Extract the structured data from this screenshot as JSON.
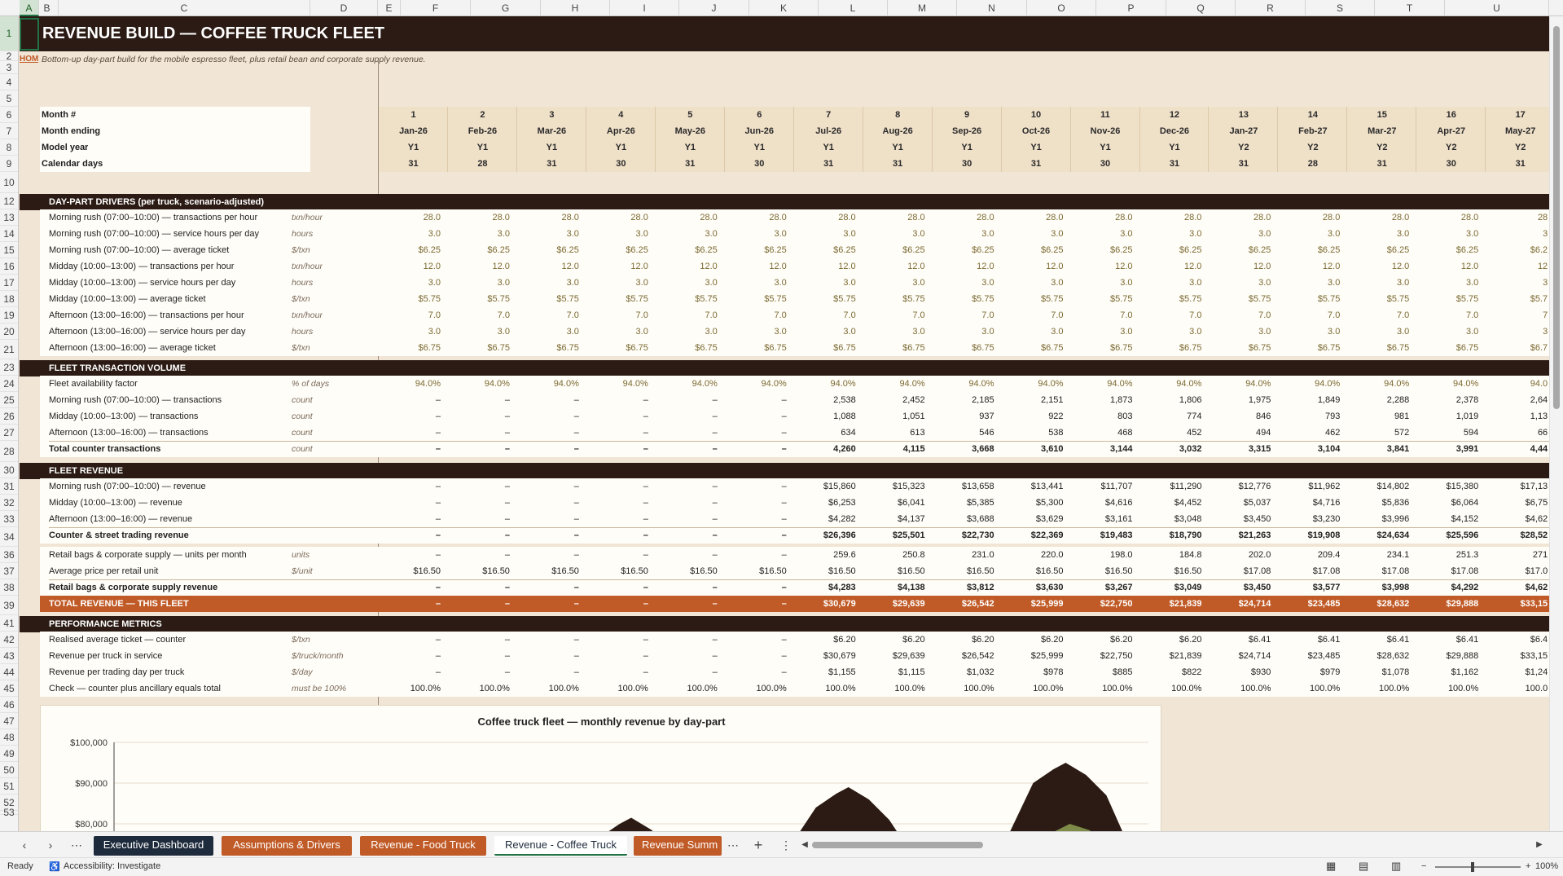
{
  "sheet": {
    "title": "REVENUE BUILD — COFFEE TRUCK FLEET",
    "home_link": "HOM",
    "subtitle": "Bottom-up day-part build for the mobile espresso fleet, plus retail bean and corporate supply revenue.",
    "timeline_labels": [
      "Month #",
      "Month ending",
      "Model year",
      "Calendar days"
    ]
  },
  "columns": [
    "A",
    "B",
    "C",
    "D",
    "E",
    "F",
    "G",
    "H",
    "I",
    "J",
    "K",
    "L",
    "M",
    "N",
    "O",
    "P",
    "Q",
    "R",
    "S",
    "T",
    "U"
  ],
  "selected_column": "A",
  "selected_row": "1",
  "rows": [
    "1",
    "2",
    "3",
    "4",
    "5",
    "6",
    "7",
    "8",
    "9",
    "10",
    "12",
    "13",
    "14",
    "15",
    "16",
    "17",
    "18",
    "19",
    "20",
    "21",
    "23",
    "24",
    "25",
    "26",
    "27",
    "28",
    "30",
    "31",
    "32",
    "33",
    "34",
    "36",
    "37",
    "38",
    "39",
    "41",
    "42",
    "43",
    "44",
    "45",
    "46",
    "47",
    "48",
    "49",
    "50",
    "51",
    "52",
    "53"
  ],
  "months": [
    {
      "n": "1",
      "end": "Jan-26",
      "yr": "Y1",
      "days": "31"
    },
    {
      "n": "2",
      "end": "Feb-26",
      "yr": "Y1",
      "days": "28"
    },
    {
      "n": "3",
      "end": "Mar-26",
      "yr": "Y1",
      "days": "31"
    },
    {
      "n": "4",
      "end": "Apr-26",
      "yr": "Y1",
      "days": "30"
    },
    {
      "n": "5",
      "end": "May-26",
      "yr": "Y1",
      "days": "31"
    },
    {
      "n": "6",
      "end": "Jun-26",
      "yr": "Y1",
      "days": "30"
    },
    {
      "n": "7",
      "end": "Jul-26",
      "yr": "Y1",
      "days": "31"
    },
    {
      "n": "8",
      "end": "Aug-26",
      "yr": "Y1",
      "days": "31"
    },
    {
      "n": "9",
      "end": "Sep-26",
      "yr": "Y1",
      "days": "30"
    },
    {
      "n": "10",
      "end": "Oct-26",
      "yr": "Y1",
      "days": "31"
    },
    {
      "n": "11",
      "end": "Nov-26",
      "yr": "Y1",
      "days": "30"
    },
    {
      "n": "12",
      "end": "Dec-26",
      "yr": "Y1",
      "days": "31"
    },
    {
      "n": "13",
      "end": "Jan-27",
      "yr": "Y2",
      "days": "31"
    },
    {
      "n": "14",
      "end": "Feb-27",
      "yr": "Y2",
      "days": "28"
    },
    {
      "n": "15",
      "end": "Mar-27",
      "yr": "Y2",
      "days": "31"
    },
    {
      "n": "16",
      "end": "Apr-27",
      "yr": "Y2",
      "days": "30"
    },
    {
      "n": "17",
      "end": "May-27",
      "yr": "Y2",
      "days": "31"
    }
  ],
  "sections": {
    "drivers": "DAY-PART DRIVERS  (per truck, scenario-adjusted)",
    "volume": "FLEET TRANSACTION VOLUME",
    "revenue": "FLEET REVENUE",
    "metrics": "PERFORMANCE METRICS"
  },
  "driver_rows": [
    {
      "label": "Morning rush (07:00–10:00) — transactions per hour",
      "unit": "txn/hour",
      "v": "28.0",
      "last": "28"
    },
    {
      "label": "Morning rush (07:00–10:00) — service hours per day",
      "unit": "hours",
      "v": "3.0",
      "last": "3"
    },
    {
      "label": "Morning rush (07:00–10:00) — average ticket",
      "unit": "$/txn",
      "v": "$6.25",
      "last": "$6.2"
    },
    {
      "label": "Midday (10:00–13:00) — transactions per hour",
      "unit": "txn/hour",
      "v": "12.0",
      "last": "12"
    },
    {
      "label": "Midday (10:00–13:00) — service hours per day",
      "unit": "hours",
      "v": "3.0",
      "last": "3"
    },
    {
      "label": "Midday (10:00–13:00) — average ticket",
      "unit": "$/txn",
      "v": "$5.75",
      "last": "$5.7"
    },
    {
      "label": "Afternoon (13:00–16:00) — transactions per hour",
      "unit": "txn/hour",
      "v": "7.0",
      "last": "7"
    },
    {
      "label": "Afternoon (13:00–16:00) — service hours per day",
      "unit": "hours",
      "v": "3.0",
      "last": "3"
    },
    {
      "label": "Afternoon (13:00–16:00) — average ticket",
      "unit": "$/txn",
      "v": "$6.75",
      "last": "$6.7"
    }
  ],
  "volume_rows": [
    {
      "label": "Fleet availability factor",
      "unit": "% of days",
      "bold": false,
      "inp": true,
      "vals": [
        "94.0%",
        "94.0%",
        "94.0%",
        "94.0%",
        "94.0%",
        "94.0%",
        "94.0%",
        "94.0%",
        "94.0%",
        "94.0%",
        "94.0%",
        "94.0%",
        "94.0%",
        "94.0%",
        "94.0%",
        "94.0%",
        "94.0"
      ]
    },
    {
      "label": "Morning rush (07:00–10:00) — transactions",
      "unit": "count",
      "bold": false,
      "inp": false,
      "vals": [
        "–",
        "–",
        "–",
        "–",
        "–",
        "–",
        "2,538",
        "2,452",
        "2,185",
        "2,151",
        "1,873",
        "1,806",
        "1,975",
        "1,849",
        "2,288",
        "2,378",
        "2,64"
      ]
    },
    {
      "label": "Midday (10:00–13:00) — transactions",
      "unit": "count",
      "bold": false,
      "inp": false,
      "vals": [
        "–",
        "–",
        "–",
        "–",
        "–",
        "–",
        "1,088",
        "1,051",
        "937",
        "922",
        "803",
        "774",
        "846",
        "793",
        "981",
        "1,019",
        "1,13"
      ]
    },
    {
      "label": "Afternoon (13:00–16:00) — transactions",
      "unit": "count",
      "bold": false,
      "inp": false,
      "vals": [
        "–",
        "–",
        "–",
        "–",
        "–",
        "–",
        "634",
        "613",
        "546",
        "538",
        "468",
        "452",
        "494",
        "462",
        "572",
        "594",
        "66"
      ]
    },
    {
      "label": "Total counter transactions",
      "unit": "count",
      "bold": true,
      "inp": false,
      "vals": [
        "–",
        "–",
        "–",
        "–",
        "–",
        "–",
        "4,260",
        "4,115",
        "3,668",
        "3,610",
        "3,144",
        "3,032",
        "3,315",
        "3,104",
        "3,841",
        "3,991",
        "4,44"
      ]
    }
  ],
  "revenue_rows": [
    {
      "label": "Morning rush (07:00–10:00) — revenue",
      "unit": "",
      "bold": false,
      "vals": [
        "–",
        "–",
        "–",
        "–",
        "–",
        "–",
        "$15,860",
        "$15,323",
        "$13,658",
        "$13,441",
        "$11,707",
        "$11,290",
        "$12,776",
        "$11,962",
        "$14,802",
        "$15,380",
        "$17,13"
      ]
    },
    {
      "label": "Midday (10:00–13:00) — revenue",
      "unit": "",
      "bold": false,
      "vals": [
        "–",
        "–",
        "–",
        "–",
        "–",
        "–",
        "$6,253",
        "$6,041",
        "$5,385",
        "$5,300",
        "$4,616",
        "$4,452",
        "$5,037",
        "$4,716",
        "$5,836",
        "$6,064",
        "$6,75"
      ]
    },
    {
      "label": "Afternoon (13:00–16:00) — revenue",
      "unit": "",
      "bold": false,
      "vals": [
        "–",
        "–",
        "–",
        "–",
        "–",
        "–",
        "$4,282",
        "$4,137",
        "$3,688",
        "$3,629",
        "$3,161",
        "$3,048",
        "$3,450",
        "$3,230",
        "$3,996",
        "$4,152",
        "$4,62"
      ]
    },
    {
      "label": "Counter & street trading revenue",
      "unit": "",
      "bold": true,
      "vals": [
        "–",
        "–",
        "–",
        "–",
        "–",
        "–",
        "$26,396",
        "$25,501",
        "$22,730",
        "$22,369",
        "$19,483",
        "$18,790",
        "$21,263",
        "$19,908",
        "$24,634",
        "$25,596",
        "$28,52"
      ]
    }
  ],
  "retail_rows": [
    {
      "label": "Retail bags & corporate supply — units per month",
      "unit": "units",
      "bold": false,
      "vals": [
        "–",
        "–",
        "–",
        "–",
        "–",
        "–",
        "259.6",
        "250.8",
        "231.0",
        "220.0",
        "198.0",
        "184.8",
        "202.0",
        "209.4",
        "234.1",
        "251.3",
        "271"
      ]
    },
    {
      "label": "Average price per retail unit",
      "unit": "$/unit",
      "bold": false,
      "vals": [
        "$16.50",
        "$16.50",
        "$16.50",
        "$16.50",
        "$16.50",
        "$16.50",
        "$16.50",
        "$16.50",
        "$16.50",
        "$16.50",
        "$16.50",
        "$16.50",
        "$17.08",
        "$17.08",
        "$17.08",
        "$17.08",
        "$17.0"
      ]
    },
    {
      "label": "Retail bags & corporate supply revenue",
      "unit": "",
      "bold": true,
      "vals": [
        "–",
        "–",
        "–",
        "–",
        "–",
        "–",
        "$4,283",
        "$4,138",
        "$3,812",
        "$3,630",
        "$3,267",
        "$3,049",
        "$3,450",
        "$3,577",
        "$3,998",
        "$4,292",
        "$4,62"
      ]
    }
  ],
  "total_row": {
    "label": "TOTAL REVENUE — THIS FLEET",
    "vals": [
      "–",
      "–",
      "–",
      "–",
      "–",
      "–",
      "$30,679",
      "$29,639",
      "$26,542",
      "$25,999",
      "$22,750",
      "$21,839",
      "$24,714",
      "$23,485",
      "$28,632",
      "$29,888",
      "$33,15"
    ]
  },
  "metric_rows": [
    {
      "label": "Realised average ticket — counter",
      "unit": "$/txn",
      "bold": false,
      "vals": [
        "–",
        "–",
        "–",
        "–",
        "–",
        "–",
        "$6.20",
        "$6.20",
        "$6.20",
        "$6.20",
        "$6.20",
        "$6.20",
        "$6.41",
        "$6.41",
        "$6.41",
        "$6.41",
        "$6.4"
      ]
    },
    {
      "label": "Revenue per truck in service",
      "unit": "$/truck/month",
      "bold": false,
      "vals": [
        "–",
        "–",
        "–",
        "–",
        "–",
        "–",
        "$30,679",
        "$29,639",
        "$26,542",
        "$25,999",
        "$22,750",
        "$21,839",
        "$24,714",
        "$23,485",
        "$28,632",
        "$29,888",
        "$33,15"
      ]
    },
    {
      "label": "Revenue per trading day per truck",
      "unit": "$/day",
      "bold": false,
      "vals": [
        "–",
        "–",
        "–",
        "–",
        "–",
        "–",
        "$1,155",
        "$1,115",
        "$1,032",
        "$978",
        "$885",
        "$822",
        "$930",
        "$979",
        "$1,078",
        "$1,162",
        "$1,24"
      ]
    },
    {
      "label": "Check — counter plus ancillary equals total",
      "unit": "must be 100%",
      "bold": false,
      "vals": [
        "100.0%",
        "100.0%",
        "100.0%",
        "100.0%",
        "100.0%",
        "100.0%",
        "100.0%",
        "100.0%",
        "100.0%",
        "100.0%",
        "100.0%",
        "100.0%",
        "100.0%",
        "100.0%",
        "100.0%",
        "100.0%",
        "100.0"
      ]
    }
  ],
  "chart_data": {
    "type": "area",
    "title": "Coffee truck fleet — monthly revenue by day-part",
    "y_ticks": [
      "$100,000",
      "$90,000",
      "$80,000"
    ],
    "ylim": [
      70000,
      100000
    ],
    "peaks": [
      {
        "x_frac": 0.5,
        "total": 81500,
        "inner": 0
      },
      {
        "x_frac": 0.71,
        "total": 89000,
        "inner": 75000
      },
      {
        "x_frac": 0.92,
        "total": 95000,
        "inner": 80000
      }
    ],
    "colors": {
      "outer": "#2b1b14",
      "inner": "#7d8a48"
    }
  },
  "tabs": [
    {
      "label": "Executive Dashboard",
      "bg": "#1e2b3c",
      "active": false
    },
    {
      "label": "Assumptions & Drivers",
      "bg": "#c05a26",
      "active": false
    },
    {
      "label": "Revenue - Food Truck",
      "bg": "#c05a26",
      "active": false
    },
    {
      "label": "Revenue - Coffee Truck",
      "bg": "#f3f3f3",
      "active": true
    },
    {
      "label": "Revenue Summ",
      "bg": "#c05a26",
      "active": false
    }
  ],
  "status": {
    "ready": "Ready",
    "accessibility": "Accessibility: Investigate",
    "zoom": "100%"
  },
  "colors": {
    "dark_band": "#2b1b14",
    "total_band": "#c05a26",
    "accent_green": "#217346"
  }
}
